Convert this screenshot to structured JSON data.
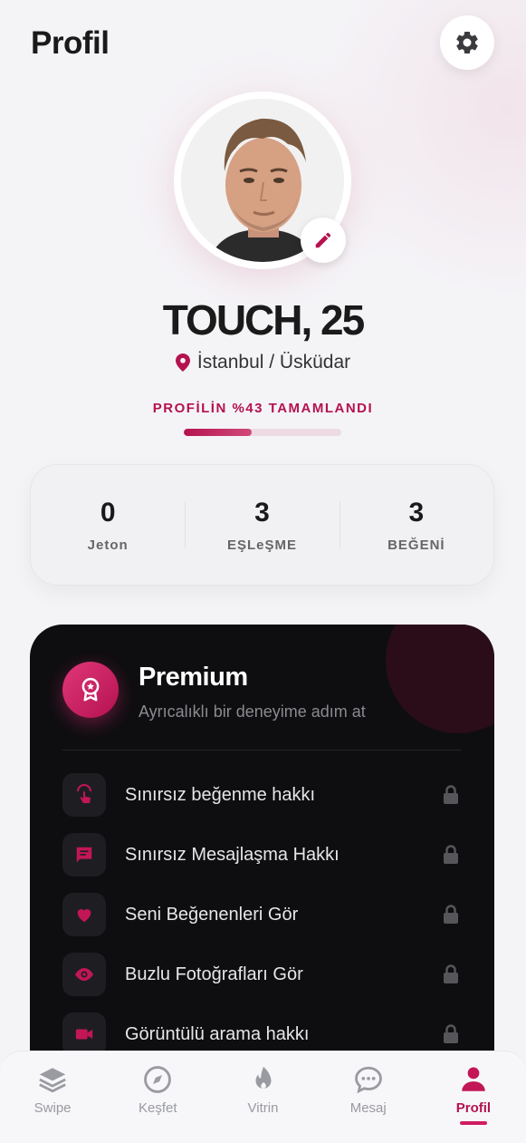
{
  "header": {
    "title": "Profil",
    "settings_icon": "gear-icon"
  },
  "profile": {
    "name_age": "TOUCH, 25",
    "location": "İstanbul / Üsküdar",
    "completion_label": "PROFİLİN %43 TAMAMLANDI",
    "completion_percent": 43,
    "edit_icon": "pencil-icon"
  },
  "stats": [
    {
      "value": "0",
      "label": "Jeton"
    },
    {
      "value": "3",
      "label": "EŞLeŞME"
    },
    {
      "value": "3",
      "label": "BEĞENİ"
    }
  ],
  "premium": {
    "title": "Premium",
    "subtitle": "Ayrıcalıklı bir deneyime adım at",
    "features": [
      {
        "label": "Sınırsız beğenme hakkı",
        "icon": "tap-icon"
      },
      {
        "label": "Sınırsız Mesajlaşma Hakkı",
        "icon": "message-icon"
      },
      {
        "label": "Seni Beğenenleri Gör",
        "icon": "heart-icon"
      },
      {
        "label": "Buzlu Fotoğrafları Gör",
        "icon": "eye-icon"
      },
      {
        "label": "Görüntülü arama hakkı",
        "icon": "video-icon"
      }
    ]
  },
  "nav": [
    {
      "label": "Swipe",
      "icon": "layers-icon",
      "active": false
    },
    {
      "label": "Keşfet",
      "icon": "compass-icon",
      "active": false
    },
    {
      "label": "Vitrin",
      "icon": "flame-icon",
      "active": false
    },
    {
      "label": "Mesaj",
      "icon": "chat-icon",
      "active": false
    },
    {
      "label": "Profil",
      "icon": "user-icon",
      "active": true
    }
  ],
  "colors": {
    "accent": "#b5124f",
    "dark_card": "#0e0e10",
    "background": "#f4f4f7"
  }
}
